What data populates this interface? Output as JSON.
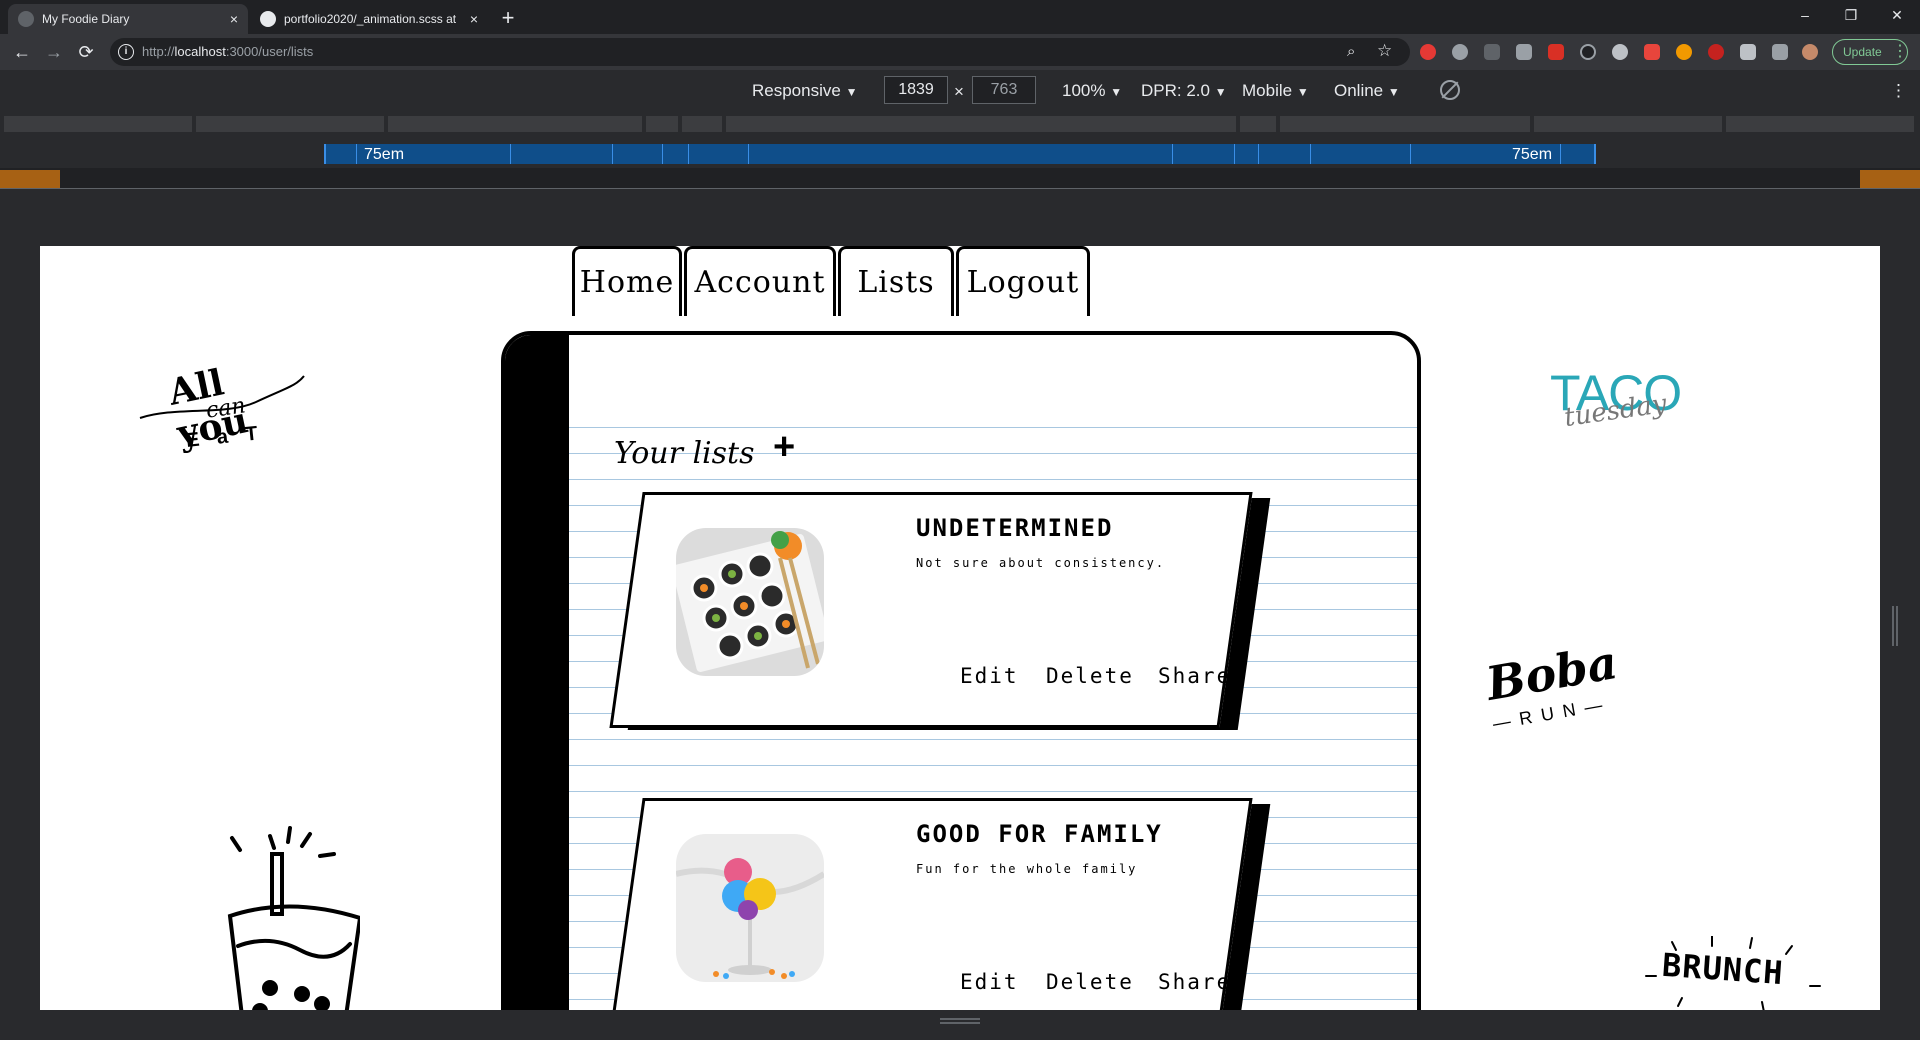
{
  "browser": {
    "tabs": [
      {
        "title": "My Foodie Diary",
        "close": "×"
      },
      {
        "title": "portfolio2020/_animation.scss at",
        "close": "×"
      }
    ],
    "new_tab": "+",
    "window": {
      "minimize": "–",
      "restore": "❐",
      "close": "✕"
    },
    "nav": {
      "back": "←",
      "forward": "→",
      "reload": "⟳"
    },
    "url_prefix": "http://",
    "url_host": "localhost",
    "url_rest": ":3000/user/lists",
    "zoom_icon": "⌕",
    "star_icon": "☆",
    "update_label": "Update",
    "menu_icon": "⋮"
  },
  "devtools": {
    "device": "Responsive",
    "width": "1839",
    "times": "×",
    "height": "763",
    "zoom": "100%",
    "dpr": "DPR: 2.0",
    "mode": "Mobile",
    "network": "Online",
    "dropdown": "▼",
    "more": "⋮",
    "mq_left": "75em",
    "mq_right": "75em"
  },
  "page": {
    "nav": {
      "home": "Home",
      "account": "Account",
      "lists": "Lists",
      "logout": "Logout"
    },
    "heading": "Your lists",
    "add_icon": "+",
    "cards": [
      {
        "title": "UNDETERMINED",
        "description": "Not sure about consistency.",
        "edit": "Edit",
        "delete": "Delete",
        "share": "Share"
      },
      {
        "title": "GOOD FOR FAMILY",
        "description": "Fun for the whole family",
        "edit": "Edit",
        "delete": "Delete",
        "share": "Share"
      }
    ],
    "doodles": {
      "all_you": "All you",
      "can": "can",
      "eat": "E a T",
      "taco": "TACO",
      "tuesday": "tuesday",
      "boba": "Boba",
      "run": "— R U N —",
      "brunch": "BRUNCH"
    }
  },
  "colors": {
    "chrome_dark": "#202124",
    "chrome_mid": "#35363a",
    "accent_green": "#81c995",
    "mq_blue": "#0f4e8a",
    "taco_teal": "#2aa7b7",
    "notebook_line": "#a8c7e0"
  }
}
